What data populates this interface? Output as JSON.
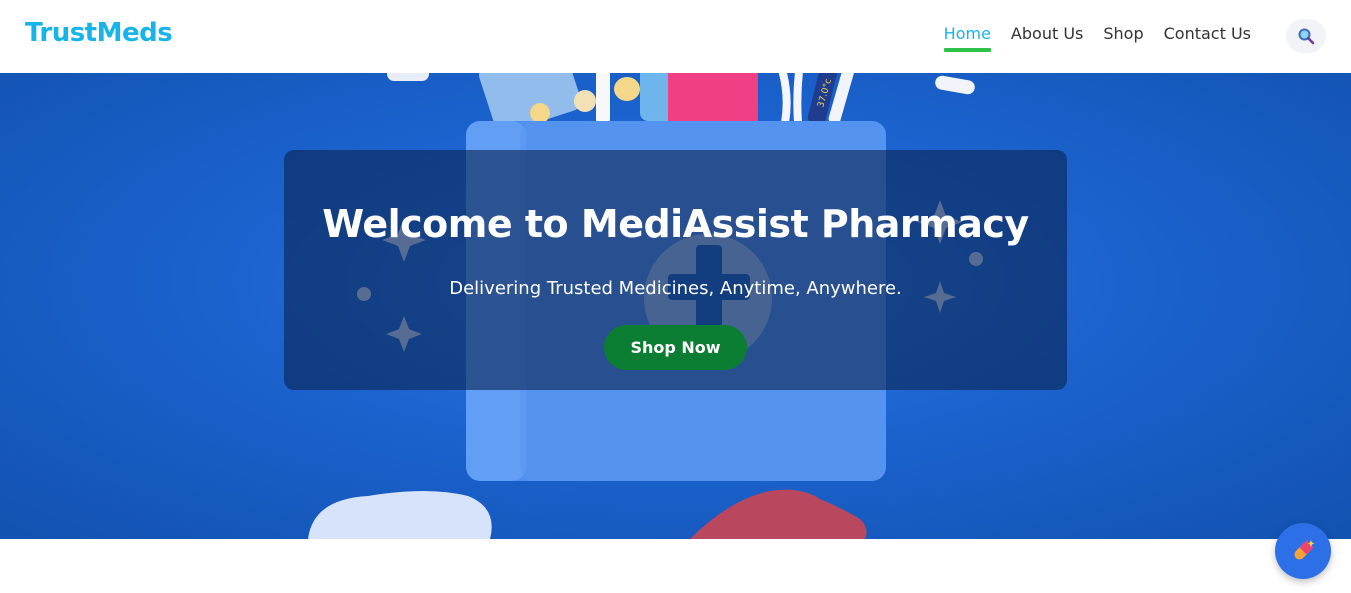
{
  "header": {
    "logo": "TrustMeds",
    "nav": [
      {
        "label": "Home",
        "active": true
      },
      {
        "label": "About Us",
        "active": false
      },
      {
        "label": "Shop",
        "active": false
      },
      {
        "label": "Contact Us",
        "active": false
      }
    ],
    "search_icon": "search-icon"
  },
  "hero": {
    "title": "Welcome to MediAssist Pharmacy",
    "subtitle": "Delivering Trusted Medicines, Anytime, Anywhere.",
    "cta_label": "Shop Now",
    "thermometer_text": "37.0°c",
    "background_illustration": "medical-kit-illustration"
  },
  "floating_button": {
    "icon": "pill-icon"
  },
  "colors": {
    "brand": "#17b4ea",
    "nav_active_underline": "#2fc24a",
    "hero_background": "#1c63cf",
    "cta_button": "#0b7e33",
    "fab": "#2d6fe6"
  }
}
